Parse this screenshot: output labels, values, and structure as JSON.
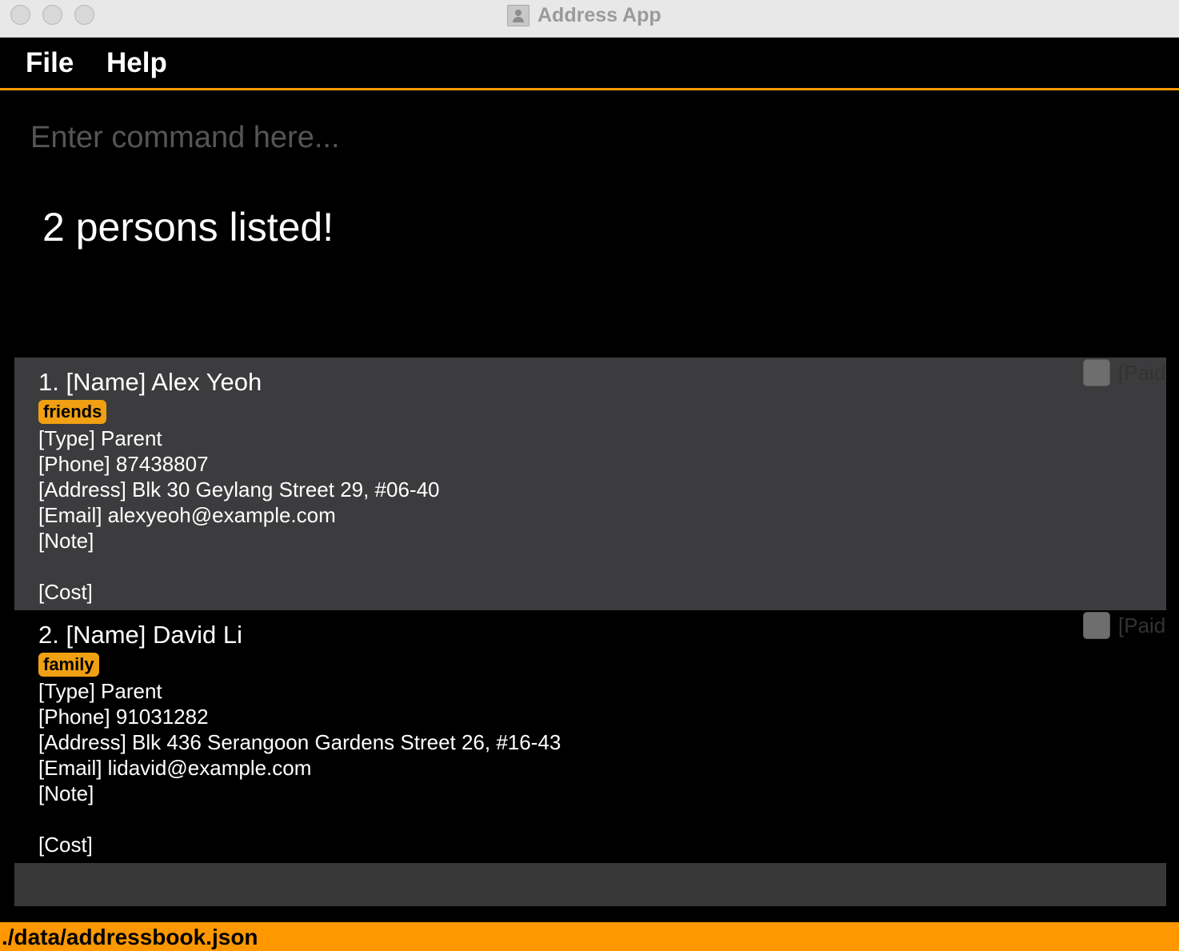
{
  "window": {
    "title": "Address App"
  },
  "menu": {
    "file": "File",
    "help": "Help"
  },
  "command": {
    "placeholder": "Enter command here...",
    "value": ""
  },
  "result": {
    "text": "2 persons listed!"
  },
  "persons": [
    {
      "name": "1. [Name] Alex Yeoh",
      "tag": "friends",
      "type": "[Type] Parent",
      "phone": "[Phone] 87438807",
      "address": "[Address] Blk 30 Geylang Street 29, #06-40",
      "email": "[Email] alexyeoh@example.com",
      "note": "[Note]",
      "cost": "[Cost]",
      "paid_label": "[Paid]",
      "paid": false
    },
    {
      "name": "2. [Name] David Li",
      "tag": "family",
      "type": "[Type] Parent",
      "phone": "[Phone] 91031282",
      "address": "[Address] Blk 436 Serangoon Gardens Street 26, #16-43",
      "email": "[Email] lidavid@example.com",
      "note": "[Note]",
      "cost": "[Cost]",
      "paid_label": "[Paid]",
      "paid": false
    }
  ],
  "status": {
    "path": "./data/addressbook.json"
  },
  "colors": {
    "accent": "#ff9800",
    "selected_card": "#3c3c3e",
    "tag": "#f0a012"
  }
}
